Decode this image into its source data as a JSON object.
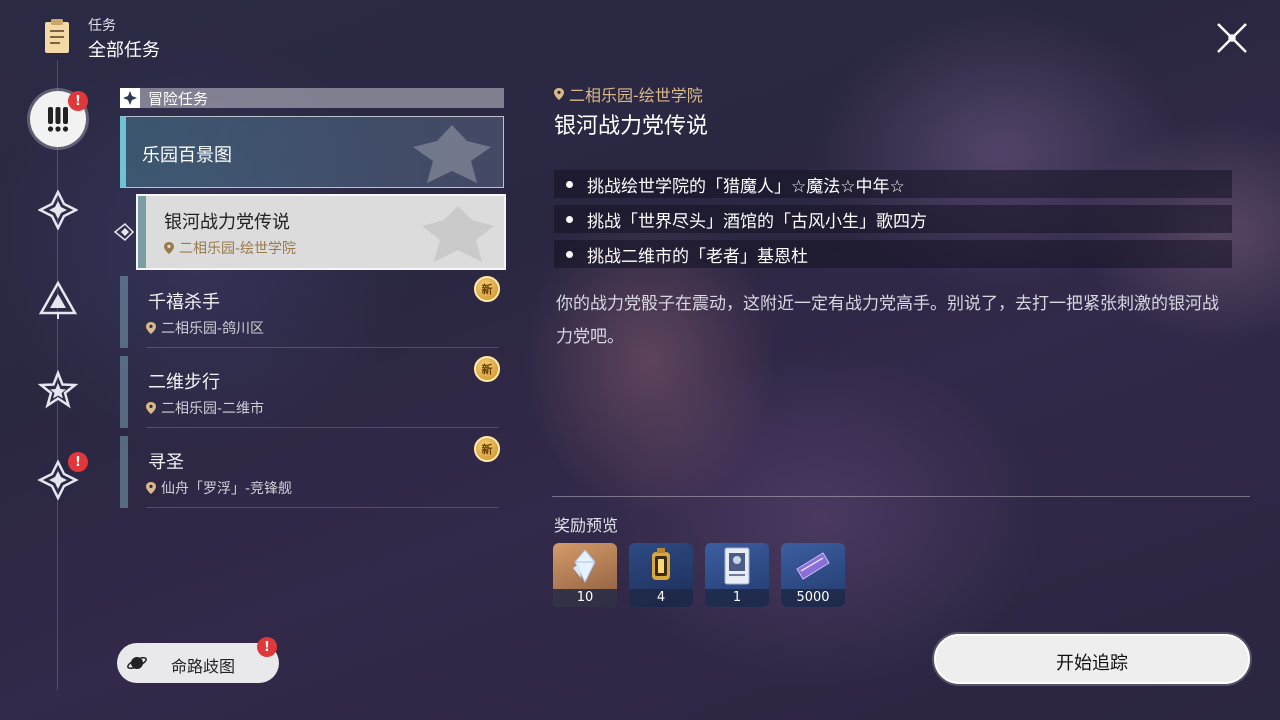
{
  "header": {
    "label": "任务",
    "title": "全部任务"
  },
  "rail": [
    {
      "icon": "exclamation-icon",
      "active": true,
      "alert": "!"
    },
    {
      "icon": "diamond-star-icon",
      "active": false
    },
    {
      "icon": "triangle-icon",
      "active": false
    },
    {
      "icon": "star-icon",
      "active": false
    },
    {
      "icon": "diamond-star-icon",
      "active": false,
      "alert": "!"
    }
  ],
  "category": {
    "label": "冒险任务"
  },
  "quest_group": {
    "label": "乐园百景图"
  },
  "quests": [
    {
      "title": "银河战力党传说",
      "location": "二相乐园-绘世学院",
      "selected": true
    },
    {
      "title": "千禧杀手",
      "location": "二相乐园-鸽川区",
      "badge": "新"
    },
    {
      "title": "二维步行",
      "location": "二相乐园-二维市",
      "badge": "新"
    },
    {
      "title": "寻圣",
      "location": "仙舟「罗浮」-竞锋舰",
      "badge": "新"
    }
  ],
  "detail": {
    "location": "二相乐园-绘世学院",
    "title": "银河战力党传说",
    "objectives": [
      "挑战绘世学院的「猎魔人」☆魔法☆中年☆",
      "挑战「世界尽头」酒馆的「古风小生」歌四方",
      "挑战二维市的「老者」基恩杜"
    ],
    "description": "你的战力党骰子在震动，这附近一定有战力党高手。别说了，去打一把紧张刺激的银河战力党吧。"
  },
  "rewards": {
    "label": "奖励预览",
    "items": [
      {
        "icon": "crystal-icon",
        "qty": "10"
      },
      {
        "icon": "lantern-icon",
        "qty": "4"
      },
      {
        "icon": "card-icon",
        "qty": "1"
      },
      {
        "icon": "ticket-icon",
        "qty": "5000"
      }
    ]
  },
  "buttons": {
    "path": "命路歧图",
    "path_alert": "!",
    "track": "开始追踪"
  }
}
